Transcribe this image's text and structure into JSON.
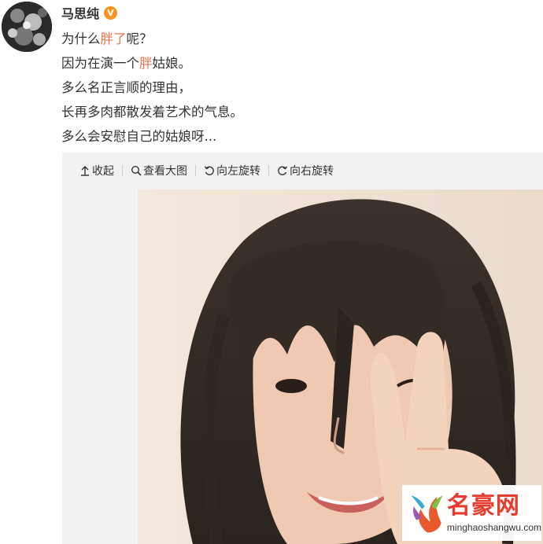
{
  "post": {
    "username": "马思纯",
    "verified_badge": "V",
    "lines": [
      {
        "segments": [
          {
            "text": "为什么"
          },
          {
            "text": "胖了",
            "highlight": true
          },
          {
            "text": "呢？"
          }
        ]
      },
      {
        "segments": [
          {
            "text": "因为在演一个"
          },
          {
            "text": "胖",
            "highlight": true
          },
          {
            "text": "姑娘。"
          }
        ]
      },
      {
        "segments": [
          {
            "text": "多么名正言顺的理由，"
          }
        ]
      },
      {
        "segments": [
          {
            "text": "长再多肉都散发着艺术的气息。"
          }
        ]
      },
      {
        "segments": [
          {
            "text": "多么会安慰自己的姑娘呀..."
          }
        ]
      }
    ]
  },
  "toolbar": {
    "collapse_label": "收起",
    "view_large_label": "查看大图",
    "rotate_left_label": "向左旋转",
    "rotate_right_label": "向右旋转",
    "icons": [
      "collapse-icon",
      "magnifier-icon",
      "rotate-left-icon",
      "rotate-right-icon"
    ]
  },
  "watermark": {
    "cn": "名豪网",
    "en": "minghaoshangwu.com"
  },
  "colors": {
    "highlight": "#eb7350",
    "badge": "#f7931e",
    "media_bg": "#f2f2f5",
    "watermark_red": "#e63c2f"
  }
}
